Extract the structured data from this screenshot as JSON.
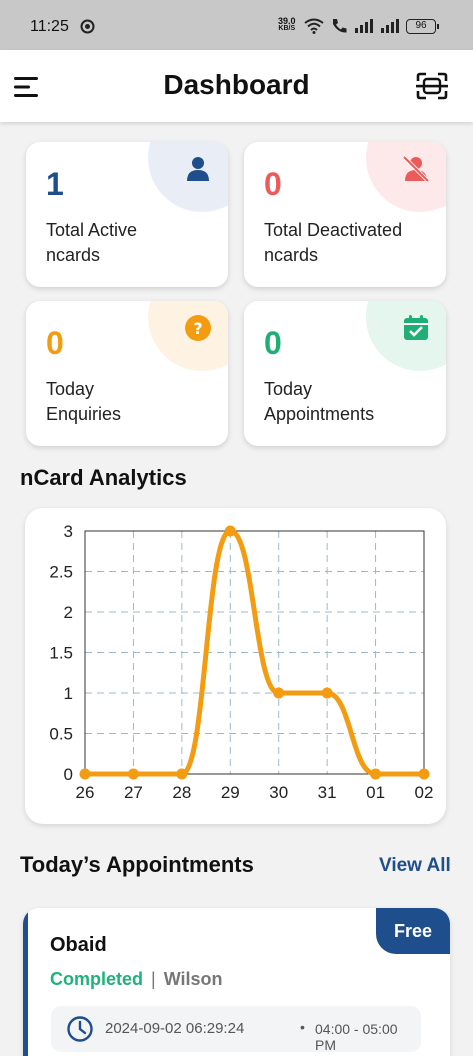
{
  "status_bar": {
    "time": "11:25",
    "net_speed": "39.0",
    "net_unit": "KB/S",
    "battery": "96"
  },
  "header": {
    "title": "Dashboard",
    "menu_icon": "hamburger-menu-icon",
    "scan_icon": "qr-scan-icon"
  },
  "stats": [
    {
      "value": "1",
      "label_line1": "Total Active",
      "label_line2": "ncards",
      "color": "#1f4e8c",
      "tint": "#e9eef6",
      "icon": "user-icon"
    },
    {
      "value": "0",
      "label_line1": "Total Deactivated",
      "label_line2": "ncards",
      "color": "#ec5b5b",
      "tint": "#fde9e9",
      "icon": "user-off-icon"
    },
    {
      "value": "0",
      "label_line1": "Today",
      "label_line2": "Enquiries",
      "color": "#f39c12",
      "tint": "#fef3e2",
      "icon": "question-icon"
    },
    {
      "value": "0",
      "label_line1": "Today",
      "label_line2": "Appointments",
      "color": "#1fae74",
      "tint": "#e4f6ee",
      "icon": "calendar-check-icon"
    }
  ],
  "analytics": {
    "title": "nCard Analytics"
  },
  "chart_data": {
    "type": "line",
    "categories": [
      "26",
      "27",
      "28",
      "29",
      "30",
      "31",
      "01",
      "02"
    ],
    "series": [
      {
        "values": [
          0,
          0,
          0,
          3,
          1,
          1,
          0,
          0
        ]
      }
    ],
    "y_ticks": [
      "0",
      "0.5",
      "1",
      "1.5",
      "2",
      "2.5",
      "3"
    ],
    "ylim": [
      0,
      3
    ],
    "grid": true,
    "color": "#f39c12",
    "smooth": true
  },
  "appointments": {
    "title": "Today’s Appointments",
    "view_all": "View All",
    "items": [
      {
        "name": "Obaid",
        "status": "Completed",
        "separator": "|",
        "with": "Wilson",
        "datetime": "2024-09-02 06:29:24",
        "bullet": "•",
        "slot": "04:00 - 05:00 PM",
        "badge": "Free"
      }
    ]
  }
}
